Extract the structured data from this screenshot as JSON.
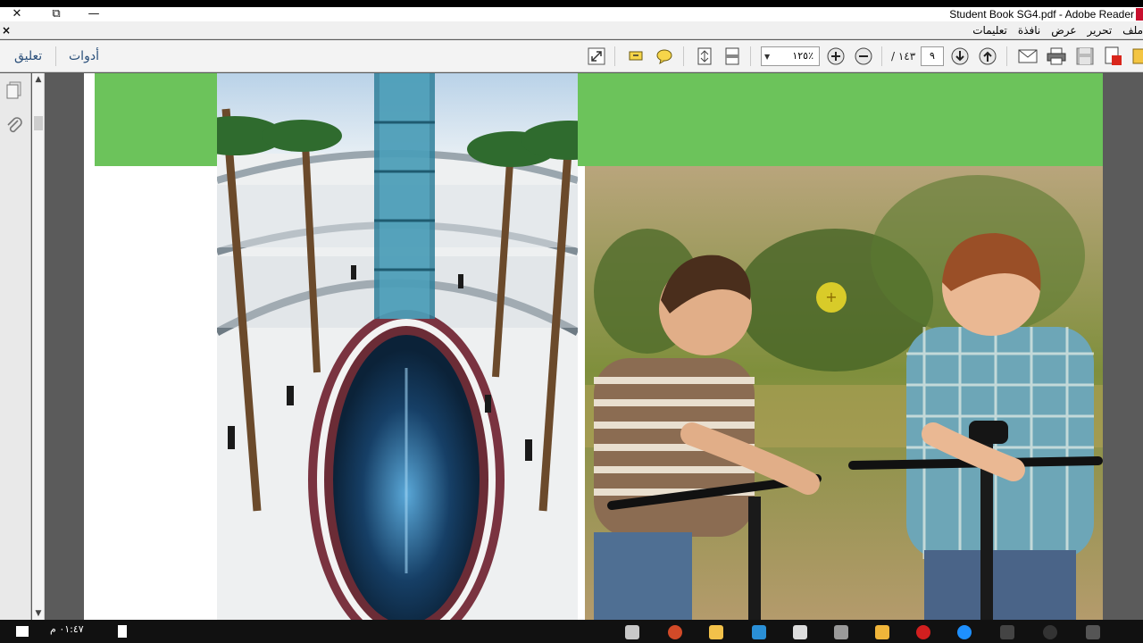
{
  "window": {
    "title": "Student Book SG4.pdf - Adobe Reader",
    "close_glyph": "✕",
    "restore_glyph": "⧉",
    "minimize_glyph": "—"
  },
  "menu": {
    "close_doc": "×",
    "items": [
      "ملف",
      "تحرير",
      "عرض",
      "نافذة",
      "تعليمات"
    ]
  },
  "toolbar": {
    "comment_label": "تعليق",
    "tools_label": "أدوات",
    "zoom_value": "١٢٥٪",
    "page_current": "٩",
    "page_total": "/ ١٤٣"
  },
  "taskbar": {
    "clock": "٠١:٤٧ م"
  },
  "colors": {
    "accent_green": "#6cc35b",
    "toolbar_link": "#2a4f7a"
  }
}
